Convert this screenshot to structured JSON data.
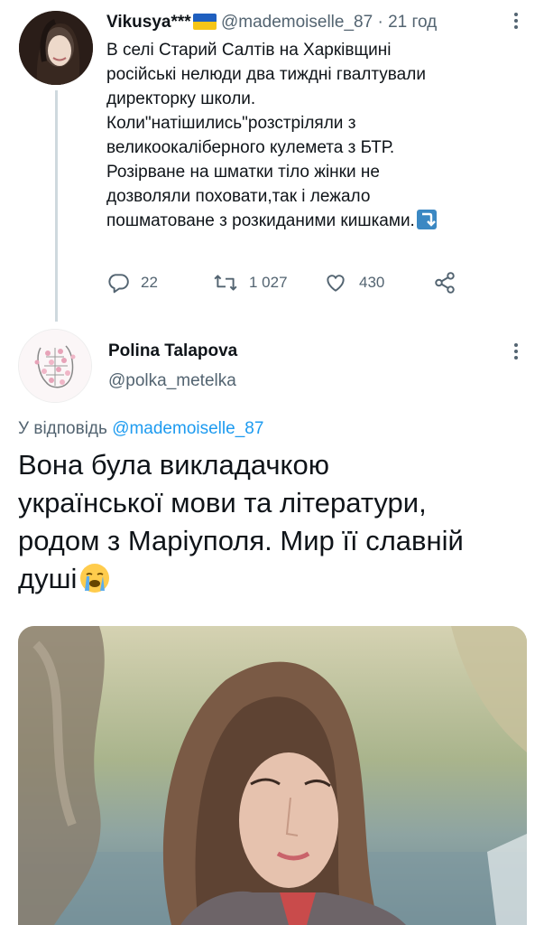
{
  "tweet1": {
    "display_name": "Vikusya***",
    "handle": "@mademoiselle_87",
    "separator": "·",
    "time": "21 год",
    "text_lines": [
      "В селі Старий Салтів на Харківщині",
      "російські нелюди два тиждні гвалтували",
      "директорку школи.",
      "Коли\"натішились\"розстріляли з",
      "великоокаліберного кулемета з БТР.",
      "Розірване на шматки тіло жінки не",
      "дозволяли поховати,так і лежало",
      "пошматоване з розкиданими кишками."
    ],
    "actions": {
      "replies": "22",
      "retweets": "1 027",
      "likes": "430"
    },
    "colors": {
      "flag_top": "#1f5fbf",
      "flag_bottom": "#f5c518",
      "accent": "#1d9bf0"
    }
  },
  "tweet2": {
    "display_name": "Polina Talapova",
    "handle": "@polka_metelka",
    "reply_prefix": "У відповідь",
    "reply_handle": "@mademoiselle_87",
    "text_lines": [
      "Вона була викладачкою",
      "української мови та літератури,",
      "родом з Маріуполя. Мир її славній",
      "душі"
    ],
    "emoji": "loudly-crying-face"
  },
  "icons": {
    "reply": "reply-icon",
    "retweet": "retweet-icon",
    "like": "heart-icon",
    "share": "share-icon",
    "more": "more-icon"
  }
}
